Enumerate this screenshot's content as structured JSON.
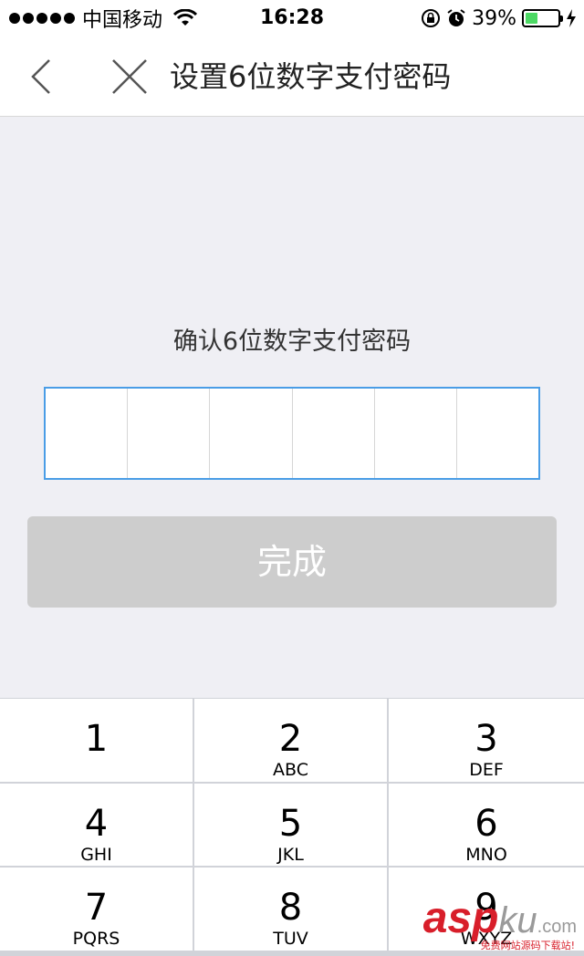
{
  "status_bar": {
    "carrier": "中国移动",
    "time": "16:28",
    "battery_percent": "39%",
    "battery_level": 0.39,
    "icons": [
      "signal-dots-icon",
      "wifi-icon",
      "rotation-lock-icon",
      "alarm-icon",
      "battery-icon",
      "charging-icon"
    ]
  },
  "nav": {
    "title": "设置6位数字支付密码",
    "back_icon": "chevron-left-icon",
    "close_icon": "close-icon"
  },
  "prompt": "确认6位数字支付密码",
  "pin_length": 6,
  "done_button": "完成",
  "keypad": {
    "keys": [
      {
        "digit": "1",
        "letters": ""
      },
      {
        "digit": "2",
        "letters": "ABC"
      },
      {
        "digit": "3",
        "letters": "DEF"
      },
      {
        "digit": "4",
        "letters": "GHI"
      },
      {
        "digit": "5",
        "letters": "JKL"
      },
      {
        "digit": "6",
        "letters": "MNO"
      },
      {
        "digit": "7",
        "letters": "PQRS"
      },
      {
        "digit": "8",
        "letters": "TUV"
      },
      {
        "digit": "9",
        "letters": "WXYZ"
      }
    ]
  },
  "watermark": {
    "text_red": "asp",
    "text_gray": "ku",
    "text_suffix": ".com",
    "subtitle": "免费网站源码下载站!"
  },
  "colors": {
    "accent_border": "#4a9de6",
    "background": "#efeff4",
    "done_button_disabled": "#cdcdcd",
    "battery_fill": "#4cd964"
  }
}
